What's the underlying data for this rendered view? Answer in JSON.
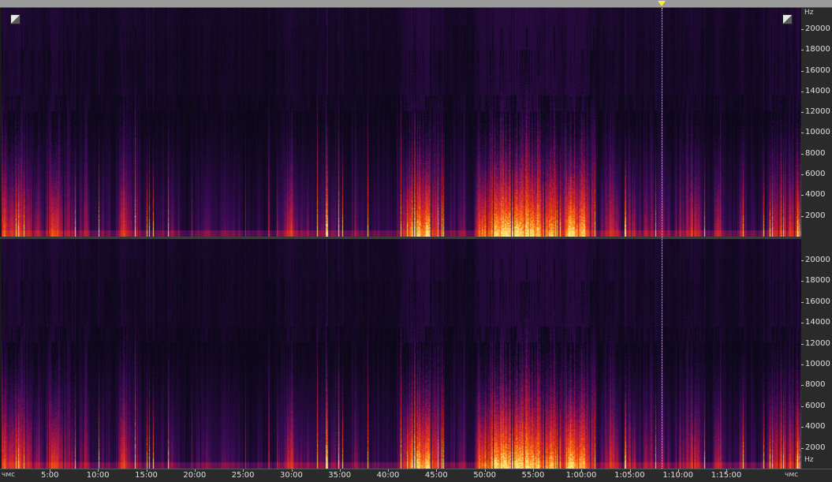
{
  "spectrogram": {
    "freq_unit": "Hz",
    "freq_labels": [
      "20000",
      "18000",
      "16000",
      "14000",
      "12000",
      "10000",
      "8000",
      "6000",
      "4000",
      "2000"
    ],
    "time_unit": "чмс",
    "time_labels": [
      "5:00",
      "10:00",
      "15:00",
      "20:00",
      "25:00",
      "30:00",
      "35:00",
      "40:00",
      "45:00",
      "50:00",
      "55:00",
      "1:00:00",
      "1:05:00",
      "1:10:00",
      "1:15:00"
    ],
    "channels": [
      "top",
      "bottom"
    ],
    "colors": {
      "background": "#0b0818",
      "low": "#3a0a5a",
      "mid": "#c0142c",
      "high": "#ff7a10",
      "peak": "#ffe070",
      "playhead": "#ffee33"
    }
  }
}
